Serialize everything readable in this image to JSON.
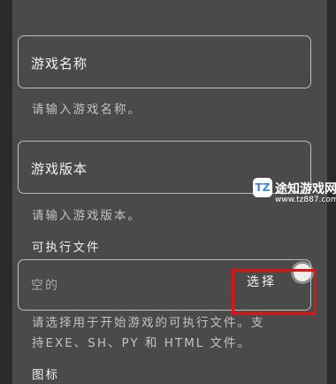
{
  "form": {
    "game_name_label": "游戏名称",
    "game_name_hint": "请输入游戏名称。",
    "game_version_label": "游戏版本",
    "game_version_hint": "请输入游戏版本。",
    "executable_section": "可执行文件",
    "executable_value": "空的",
    "choose_button": "选择",
    "executable_hint_line1": "请选择用于开始游戏的可执行文件。支",
    "executable_hint_line2": "持EXE、SH、PY 和 HTML 文件。",
    "icon_section": "图标"
  },
  "watermark": {
    "logo_text": "TZ",
    "name": "途知游戏网",
    "url": "www.tz887.com"
  },
  "colors": {
    "panel": "#4a4a4a",
    "highlight": "#e01212"
  }
}
